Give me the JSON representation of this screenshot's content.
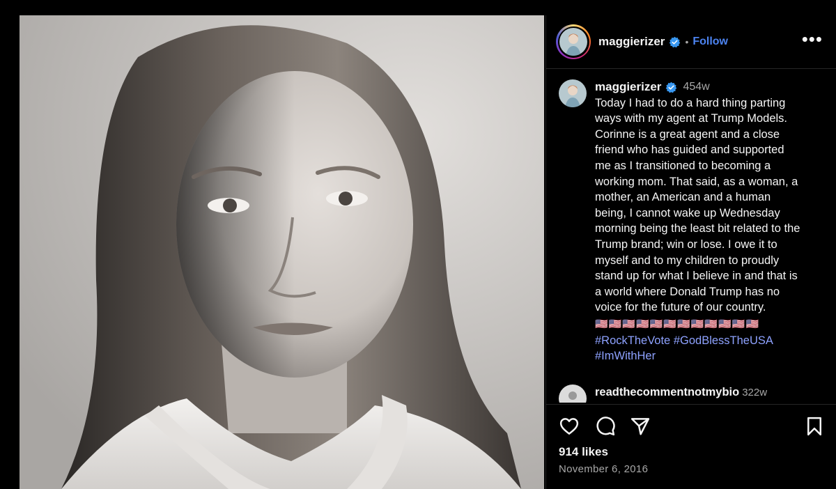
{
  "post": {
    "username": "maggierizer",
    "follow_label": "Follow",
    "separator": "•",
    "more_label": "•••",
    "caption": {
      "username": "maggierizer",
      "time": "454w",
      "text": "Today I had to do a hard thing parting\nways with my agent at Trump Models.\nCorinne is a great agent and a close\nfriend who has guided and supported\nme as I transitioned to becoming a\nworking mom. That said, as a woman, a\nmother, an American and a human\nbeing, I cannot wake up Wednesday\nmorning being the least bit related to the\nTrump brand; win or lose. I owe it to\nmyself and to my children to proudly\nstand up for what I believe in and that is\na world where Donald Trump has no\nvoice for the future of our country.",
      "flags": "🇺🇸🇺🇸🇺🇸🇺🇸🇺🇸🇺🇸🇺🇸🇺🇸🇺🇸🇺🇸🇺🇸🇺🇸",
      "hashtags": [
        "#RockTheVote",
        "#GodBlessTheUSA",
        "#ImWithHer"
      ]
    },
    "comment": {
      "username": "readthecommentnotmybio",
      "time": "322w"
    },
    "likes": "914 likes",
    "date": "November 6, 2016"
  },
  "icons": [
    "verified-badge-icon",
    "heart-icon",
    "comment-icon",
    "share-icon",
    "bookmark-icon",
    "more-options-icon"
  ],
  "colors": {
    "accent": "#4c83f0",
    "hashtag": "#8ea2ff",
    "background": "#000000",
    "muted": "#a8a8a8"
  }
}
